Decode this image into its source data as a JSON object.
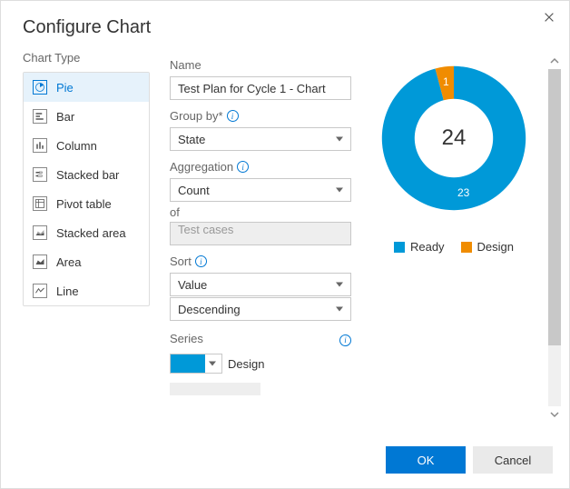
{
  "dialog": {
    "title": "Configure Chart",
    "ok_label": "OK",
    "cancel_label": "Cancel"
  },
  "chart_type": {
    "label": "Chart Type",
    "items": [
      {
        "id": "pie",
        "label": "Pie",
        "selected": true
      },
      {
        "id": "bar",
        "label": "Bar",
        "selected": false
      },
      {
        "id": "column",
        "label": "Column",
        "selected": false
      },
      {
        "id": "stacked-bar",
        "label": "Stacked bar",
        "selected": false
      },
      {
        "id": "pivot-table",
        "label": "Pivot table",
        "selected": false
      },
      {
        "id": "stacked-area",
        "label": "Stacked area",
        "selected": false
      },
      {
        "id": "area",
        "label": "Area",
        "selected": false
      },
      {
        "id": "line",
        "label": "Line",
        "selected": false
      }
    ]
  },
  "form": {
    "name_label": "Name",
    "name_value": "Test Plan for Cycle 1 - Chart",
    "groupby_label": "Group by*",
    "groupby_value": "State",
    "aggregation_label": "Aggregation",
    "aggregation_value": "Count",
    "of_label": "of",
    "of_value": "Test cases",
    "sort_label": "Sort",
    "sort_by_value": "Value",
    "sort_dir_value": "Descending",
    "series_label": "Series",
    "series_color": "#0099d8",
    "series_item_label": "Design"
  },
  "chart_data": {
    "type": "pie",
    "title": "",
    "total": 24,
    "categories": [
      "Ready",
      "Design"
    ],
    "values": [
      23,
      1
    ],
    "colors": {
      "Ready": "#0099d8",
      "Design": "#f08c00"
    },
    "legend_position": "bottom"
  }
}
